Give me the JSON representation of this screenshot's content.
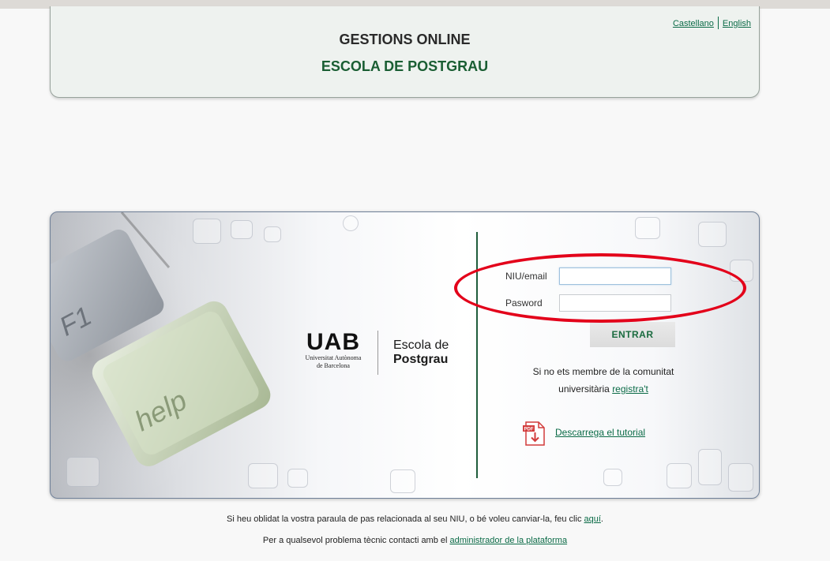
{
  "header": {
    "title": "GESTIONS ONLINE",
    "subtitle": "ESCOLA DE POSTGRAU",
    "lang_castellano": "Castellano",
    "lang_english": "English"
  },
  "logo": {
    "mark": "UAB",
    "university_line1": "Universitat Autònoma",
    "university_line2": "de Barcelona",
    "school_line1": "Escola de",
    "school_line2": "Postgrau"
  },
  "decor_keys": {
    "key1": "F1",
    "key2": "help"
  },
  "login": {
    "user_label": "NIU/email",
    "user_value": "",
    "password_label": "Pasword",
    "password_value": "",
    "submit_label": "ENTRAR",
    "register_text_1": "Si no ets membre de la comunitat",
    "register_text_2": "universitària ",
    "register_link": "registra't",
    "pdf_icon_text": "PDF",
    "tutorial_link": "Descarrega el tutorial"
  },
  "footer": {
    "line1_text": "Si heu oblidat la vostra paraula de pas relacionada al seu NIU, o bé voleu canviar-la, feu clic ",
    "line1_link": "aquí",
    "line1_end": ".",
    "line2_text": "Per a qualsevol problema tècnic contacti amb el ",
    "line2_link": "administrador de la plataforma"
  },
  "colors": {
    "brand_green": "#1a5e33",
    "link_green": "#0b6b47",
    "highlight_red": "#e3001a"
  },
  "icons": [
    "pdf-download-icon"
  ]
}
